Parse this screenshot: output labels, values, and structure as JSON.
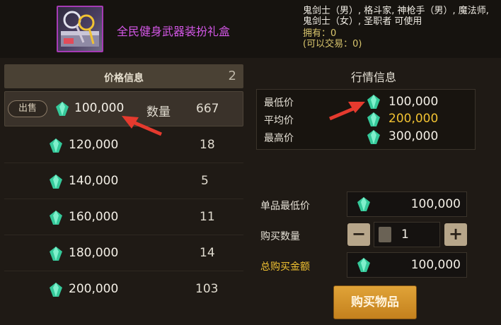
{
  "item": {
    "name": "全民健身武器装扮礼盒",
    "requirement": "鬼剑士（男）, 格斗家, 神枪手（男）, 魔法师, 鬼剑士（女）, 圣职者 可使用",
    "owned": "拥有：0",
    "tradable": "(可以交易：0)"
  },
  "price_panel": {
    "title": "价格信息",
    "count": "2",
    "sell_label": "出售",
    "qty_label": "数量",
    "listings": [
      {
        "price": "100,000",
        "qty": "667"
      },
      {
        "price": "120,000",
        "qty": "18"
      },
      {
        "price": "140,000",
        "qty": "5"
      },
      {
        "price": "160,000",
        "qty": "11"
      },
      {
        "price": "180,000",
        "qty": "14"
      },
      {
        "price": "200,000",
        "qty": "103"
      }
    ]
  },
  "market": {
    "title": "行情信息",
    "min_label": "最低价",
    "min_value": "100,000",
    "avg_label": "平均价",
    "avg_value": "200,000",
    "max_label": "最高价",
    "max_value": "300,000"
  },
  "purchase": {
    "unit_min_label": "单品最低价",
    "unit_min_value": "100,000",
    "qty_label": "购买数量",
    "qty_value": "1",
    "total_label": "总购买金额",
    "total_value": "100,000",
    "minus": "−",
    "plus": "+",
    "buy_label": "购买物品"
  },
  "colors": {
    "accent_gold": "#f1c232",
    "item_name": "#d357e6",
    "arrow": "#e53a2e",
    "gem": "#35c99a"
  }
}
